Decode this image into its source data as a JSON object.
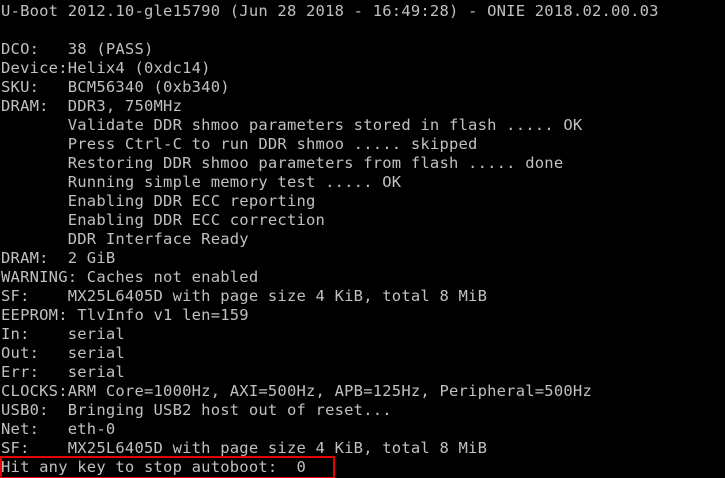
{
  "terminal": {
    "lines": [
      "U-Boot 2012.10-gle15790 (Jun 28 2018 - 16:49:28) - ONIE 2018.02.00.03",
      "",
      "DCO:   38 (PASS)",
      "Device:Helix4 (0xdc14)",
      "SKU:   BCM56340 (0xb340)",
      "DRAM:  DDR3, 750MHz",
      "       Validate DDR shmoo parameters stored in flash ..... OK",
      "       Press Ctrl-C to run DDR shmoo ..... skipped",
      "       Restoring DDR shmoo parameters from flash ..... done",
      "       Running simple memory test ..... OK",
      "       Enabling DDR ECC reporting",
      "       Enabling DDR ECC correction",
      "       DDR Interface Ready",
      "DRAM:  2 GiB",
      "WARNING: Caches not enabled",
      "SF:    MX25L6405D with page size 4 KiB, total 8 MiB",
      "EEPROM: TlvInfo v1 len=159",
      "In:    serial",
      "Out:   serial",
      "Err:   serial",
      "CLOCKS:ARM Core=1000Hz, AXI=500Hz, APB=125Hz, Peripheral=500Hz",
      "USB0:  Bringing USB2 host out of reset...",
      "Net:   eth-0",
      "SF:    MX25L6405D with page size 4 KiB, total 8 MiB",
      "Hit any key to stop autoboot:  0"
    ]
  },
  "colors": {
    "background": "#000000",
    "text": "#c0c0c0",
    "highlight_border": "#e60000"
  }
}
